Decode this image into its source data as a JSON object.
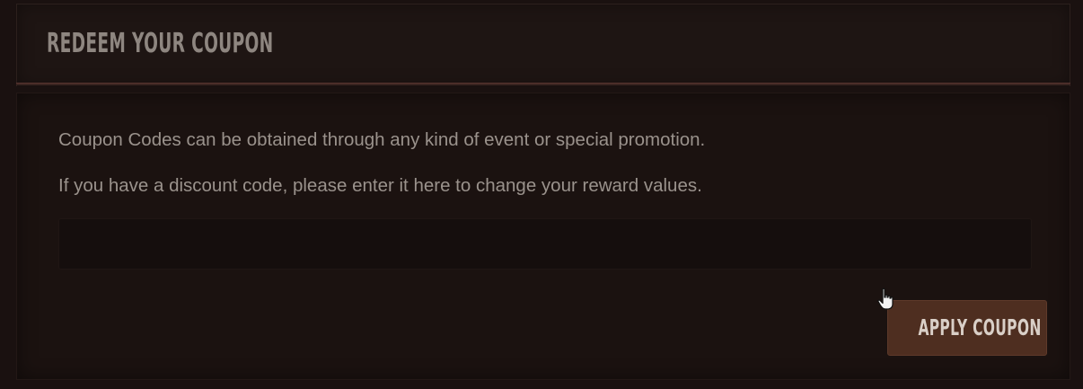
{
  "header": {
    "title": "REDEEM YOUR COUPON"
  },
  "body": {
    "line1": "Coupon Codes can be obtained through any kind of event or special promotion.",
    "line2": "If you have a discount code, please enter it here to change your reward values."
  },
  "coupon_input": {
    "value": "",
    "placeholder": ""
  },
  "apply_button": {
    "label": "APPLY COUPON"
  },
  "colors": {
    "background": "#1a1110",
    "panel": "#1e1513",
    "accent_divider": "#5a3530",
    "button": "#4e2e20",
    "text_muted": "#9a928c"
  },
  "icons": {
    "cursor": "hand-pointer-icon"
  }
}
